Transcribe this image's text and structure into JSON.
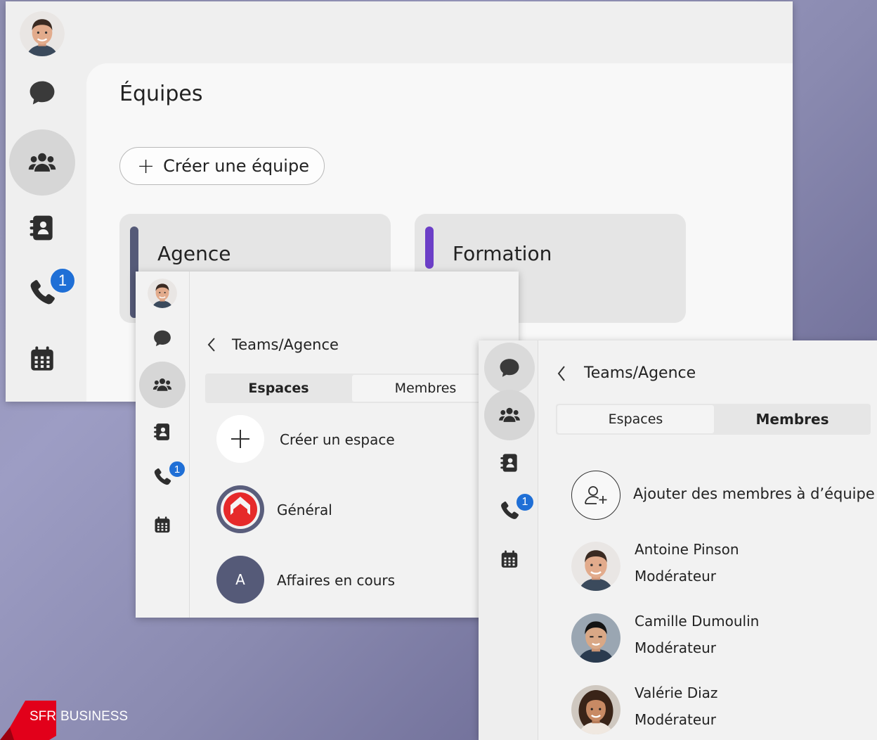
{
  "window1": {
    "title": "Équipes",
    "create_team_label": "Créer une équipe",
    "teams": [
      {
        "name": "Agence",
        "color": "#555a78"
      },
      {
        "name": "Formation",
        "color": "#6c3fc7"
      }
    ],
    "call_badge": "1"
  },
  "window2": {
    "breadcrumb": "Teams/Agence",
    "tabs": [
      "Espaces",
      "Membres"
    ],
    "active_tab": "Espaces",
    "create_space_label": "Créer un espace",
    "spaces": [
      {
        "name": "Général",
        "icon": "sfr-logo"
      },
      {
        "name": "Affaires en cours",
        "initial": "A"
      }
    ],
    "call_badge": "1"
  },
  "window3": {
    "breadcrumb": "Teams/Agence",
    "tabs": [
      "Espaces",
      "Membres"
    ],
    "active_tab": "Membres",
    "add_members_label": "Ajouter des membres à d’équipe",
    "members": [
      {
        "name": "Antoine Pinson",
        "role": "Modérateur"
      },
      {
        "name": "Camille Dumoulin",
        "role": "Modérateur"
      },
      {
        "name": "Valérie Diaz",
        "role": "Modérateur"
      }
    ],
    "call_badge": "1"
  },
  "brand": {
    "sfr": "SFR",
    "business": "BUSINESS",
    "color": "#e2001a"
  }
}
